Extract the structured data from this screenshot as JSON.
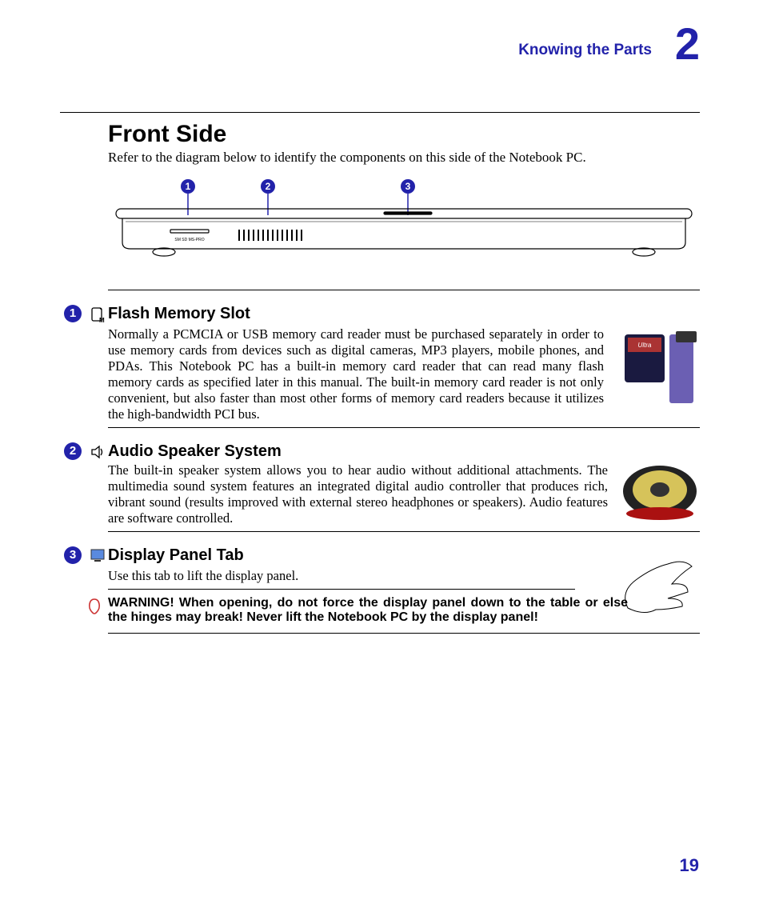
{
  "header": {
    "section": "Knowing the Parts",
    "chapter": "2"
  },
  "title": "Front Side",
  "intro": "Refer to the diagram below to identify the components on this side of the Notebook PC.",
  "callouts": [
    "1",
    "2",
    "3"
  ],
  "items": [
    {
      "num": "1",
      "icon": "memory-card-icon",
      "title": "Flash Memory Slot",
      "body": "Normally a PCMCIA or USB memory card reader must be purchased separately in order to use memory cards from devices such as digital cameras, MP3 players, mobile phones, and PDAs. This Notebook PC has a built-in memory card reader that can read many flash memory cards as specified later in this manual. The built-in memory card reader is not only convenient, but also faster than most other forms of memory card readers because it utilizes the high-bandwidth PCI bus."
    },
    {
      "num": "2",
      "icon": "speaker-icon",
      "title": "Audio Speaker System",
      "body": "The built-in speaker system allows you to hear audio without additional attachments. The multimedia sound system features an integrated digital audio controller that produces rich, vibrant sound (results improved with external stereo headphones or speakers). Audio features are software controlled."
    },
    {
      "num": "3",
      "icon": "display-icon",
      "title": "Display Panel Tab",
      "body": "Use this tab to lift the display panel."
    }
  ],
  "warning": "WARNING!  When opening, do not force the display panel down to the table or else the hinges may break! Never lift the Notebook PC by the display panel!",
  "page_number": "19",
  "diagram_label": "SM SD MS-PRO"
}
